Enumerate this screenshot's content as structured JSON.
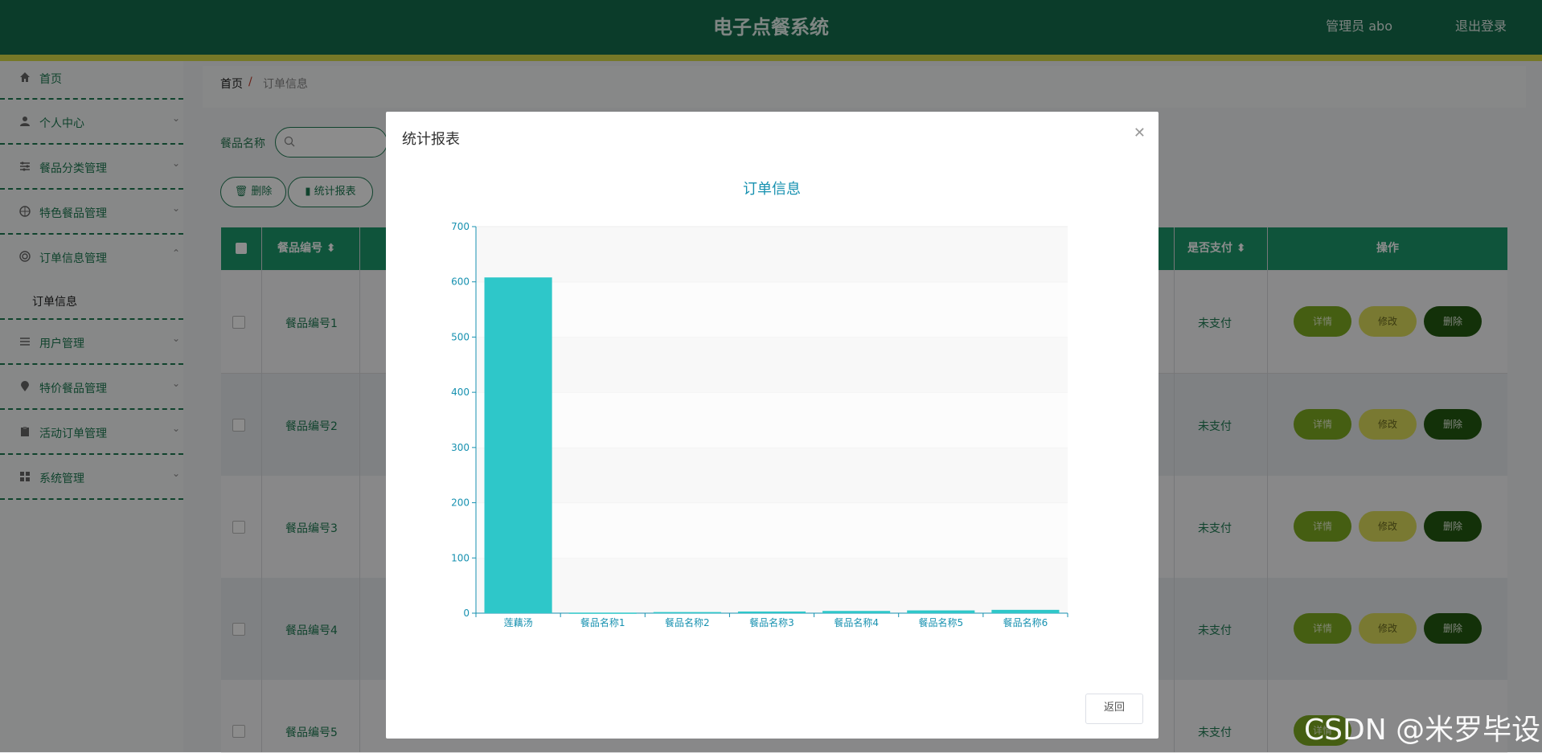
{
  "header": {
    "app_title": "电子点餐系统",
    "admin": "管理员 abo",
    "logout": "退出登录"
  },
  "sidebar": {
    "items": [
      {
        "label": "首页",
        "icon": "home-icon"
      },
      {
        "label": "个人中心",
        "icon": "user-icon"
      },
      {
        "label": "餐品分类管理",
        "icon": "sliders-icon"
      },
      {
        "label": "特色餐品管理",
        "icon": "compass-icon"
      },
      {
        "label": "订单信息管理",
        "icon": "order-icon"
      },
      {
        "label": "用户管理",
        "icon": "list-icon"
      },
      {
        "label": "特价餐品管理",
        "icon": "location-icon"
      },
      {
        "label": "活动订单管理",
        "icon": "clipboard-icon"
      },
      {
        "label": "系统管理",
        "icon": "grid-icon"
      }
    ],
    "sub_item": "订单信息"
  },
  "breadcrumb": {
    "home": "首页",
    "sep": "/",
    "current": "订单信息"
  },
  "search": {
    "label": "餐品名称"
  },
  "toolbar": {
    "delete": "删除",
    "report": "统计报表"
  },
  "table": {
    "headers": {
      "code": "餐品编号",
      "paid": "是否支付",
      "ops": "操作"
    },
    "rows": [
      {
        "code": "餐品编号1",
        "paid": "未支付"
      },
      {
        "code": "餐品编号2",
        "paid": "未支付"
      },
      {
        "code": "餐品编号3",
        "paid": "未支付"
      },
      {
        "code": "餐品编号4",
        "paid": "未支付"
      },
      {
        "code": "餐品编号5",
        "paid": "未支付"
      }
    ],
    "op_labels": {
      "detail": "详情",
      "edit": "修改",
      "delete": "删除"
    }
  },
  "modal": {
    "title": "统计报表",
    "return": "返回"
  },
  "chart_data": {
    "type": "bar",
    "title": "订单信息",
    "categories": [
      "莲藕汤",
      "餐品名称1",
      "餐品名称2",
      "餐品名称3",
      "餐品名称4",
      "餐品名称5",
      "餐品名称6"
    ],
    "values": [
      608,
      1,
      2,
      3,
      4,
      5,
      6
    ],
    "ylim": [
      0,
      700
    ],
    "yticks": [
      0,
      100,
      200,
      300,
      400,
      500,
      600,
      700
    ],
    "color": "#2ec7c9"
  },
  "watermark": "CSDN @米罗毕设"
}
